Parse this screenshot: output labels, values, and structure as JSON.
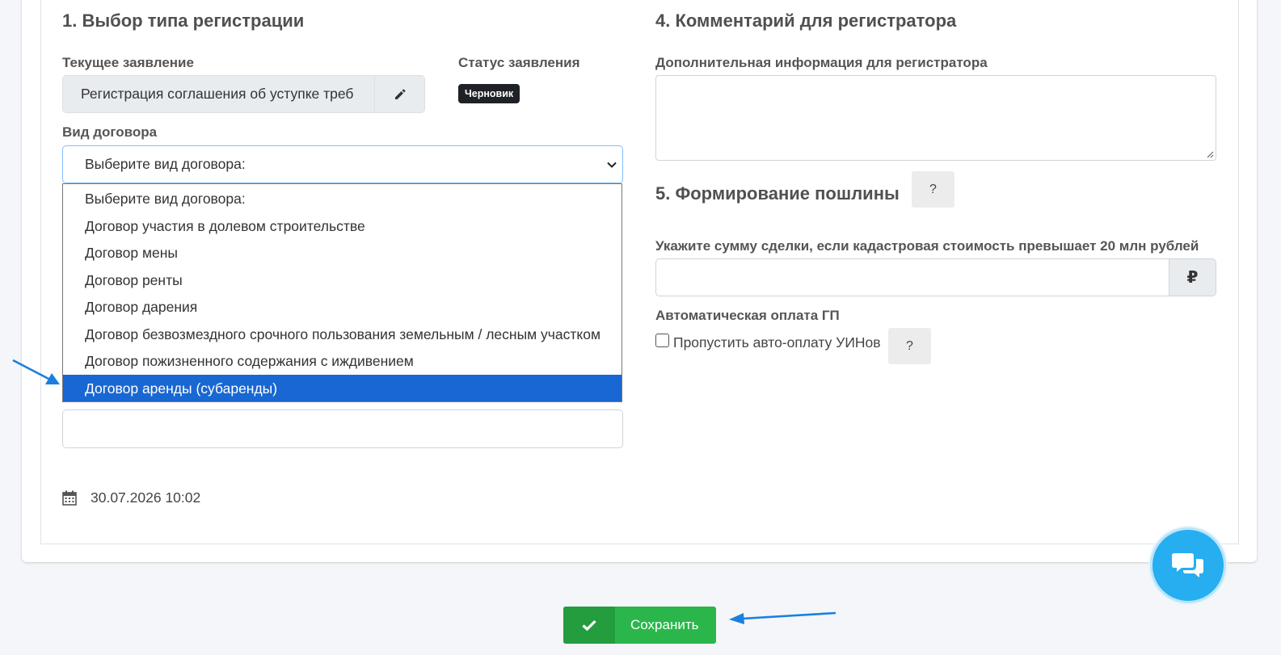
{
  "section1": {
    "title": "1. Выбор типа регистрации",
    "current_app_label": "Текущее заявление",
    "current_app_value": "Регистрация соглашения об уступке треб",
    "status_label": "Статус заявления",
    "status_badge": "Черновик",
    "contract_type_label": "Вид договора",
    "contract_type_selected": "Выберите вид договора:",
    "options": [
      "Выберите вид договора:",
      "Договор участия в долевом строительстве",
      "Договор мены",
      "Договор ренты",
      "Договор дарения",
      "Договор безвозмездного срочного пользования земельным / лесным участком",
      "Договор пожизненного содержания с иждивением",
      "Договор аренды (субаренды)"
    ],
    "highlighted_option": "Договор аренды (субаренды)",
    "date": "30.07.2026 10:02"
  },
  "section4": {
    "title": "4. Комментарий для регистратора",
    "info_label": "Дополнительная информация для регистратора"
  },
  "section5": {
    "title": "5. Формирование пошлины",
    "help": "?",
    "sum_label": "Укажите сумму сделки, если кадастровая стоимость превышает 20 млн рублей",
    "currency": "₽",
    "auto_pay_label": "Автоматическая оплата ГП",
    "skip_label": "Пропустить авто-оплату УИНов",
    "skip_help": "?"
  },
  "footer": {
    "save_label": "Сохранить"
  },
  "colors": {
    "accent_blue": "#1967d2",
    "save_green": "#2bb64b",
    "chat_blue": "#26aef0",
    "annotation_arrow": "#1a7fe0"
  }
}
